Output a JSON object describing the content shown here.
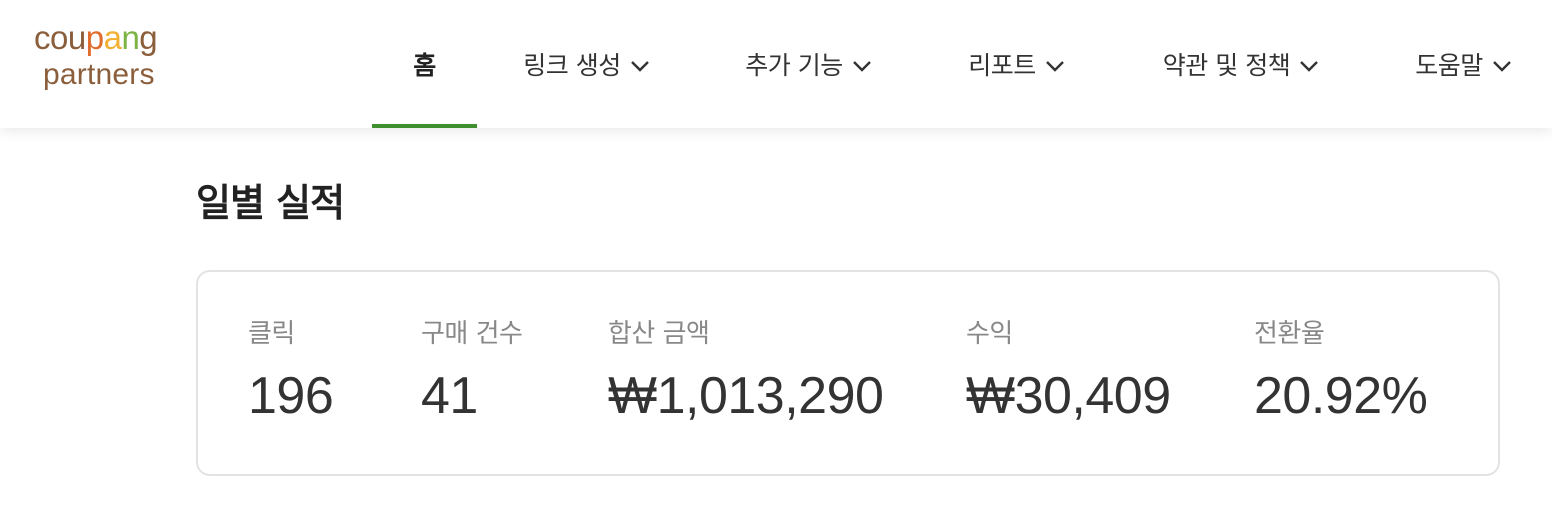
{
  "header": {
    "logo": {
      "top_word": "coupang",
      "bottom_word": "partners",
      "letter_colors": [
        "#8b5e3c",
        "#8b5e3c",
        "#8b5e3c",
        "#e06c2d",
        "#f2b134",
        "#7cb342",
        "#8b5e3c",
        "#4fa3d8"
      ]
    },
    "nav": {
      "items": [
        {
          "label": "홈",
          "active": true
        },
        {
          "label": "링크 생성",
          "dropdown": true
        },
        {
          "label": "추가 기능",
          "dropdown": true
        },
        {
          "label": "리포트",
          "dropdown": true
        },
        {
          "label": "약관 및 정책",
          "dropdown": true
        },
        {
          "label": "도움말",
          "dropdown": true
        }
      ],
      "active_underline_color": "#3f8f2e"
    }
  },
  "main": {
    "title": "일별 실적",
    "stats": [
      {
        "label": "클릭",
        "value": "196"
      },
      {
        "label": "구매 건수",
        "value": "41"
      },
      {
        "label": "합산 금액",
        "value": "₩1,013,290"
      },
      {
        "label": "수익",
        "value": "₩30,409"
      },
      {
        "label": "전환율",
        "value": "20.92%"
      }
    ]
  }
}
